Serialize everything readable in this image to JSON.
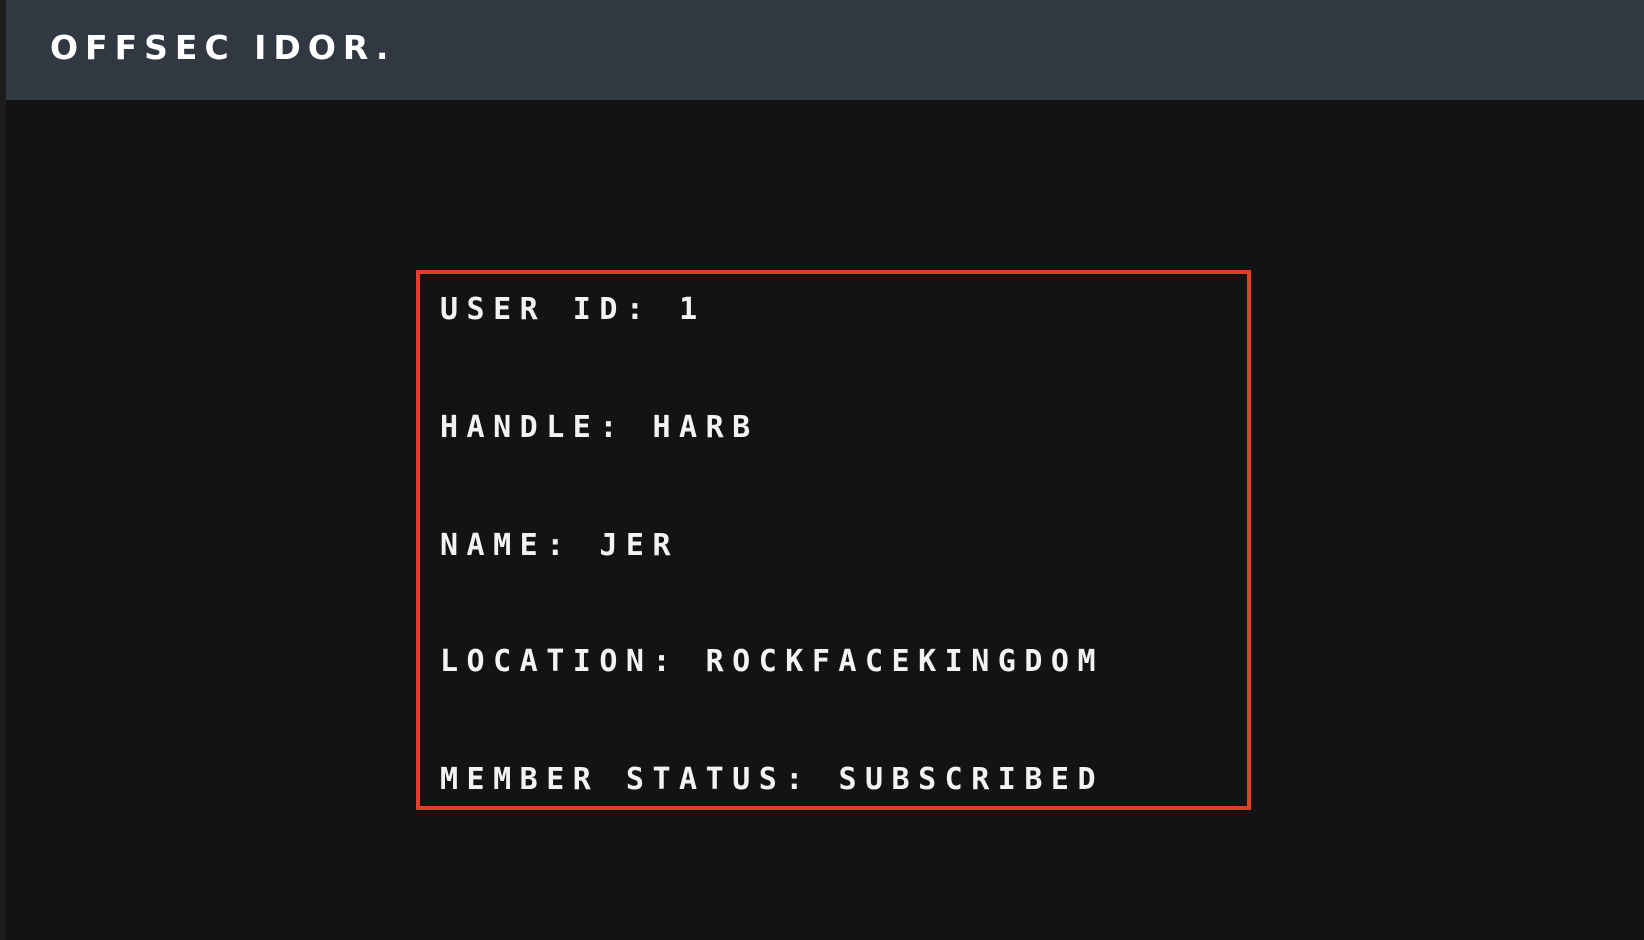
{
  "header": {
    "brand": "OFFSEC IDOR."
  },
  "user": {
    "fields": [
      {
        "label": "USER ID:",
        "value": "1"
      },
      {
        "label": "HANDLE:",
        "value": "HARB"
      },
      {
        "label": "NAME:",
        "value": "JER"
      },
      {
        "label": "LOCATION:",
        "value": "ROCKFACEKINGDOM"
      },
      {
        "label": "MEMBER STATUS:",
        "value": "SUBSCRIBED"
      }
    ]
  },
  "colors": {
    "page_background": "#131313",
    "navbar_background": "#323842",
    "highlight_border": "#e0402a",
    "text": "#f3f3f3"
  }
}
